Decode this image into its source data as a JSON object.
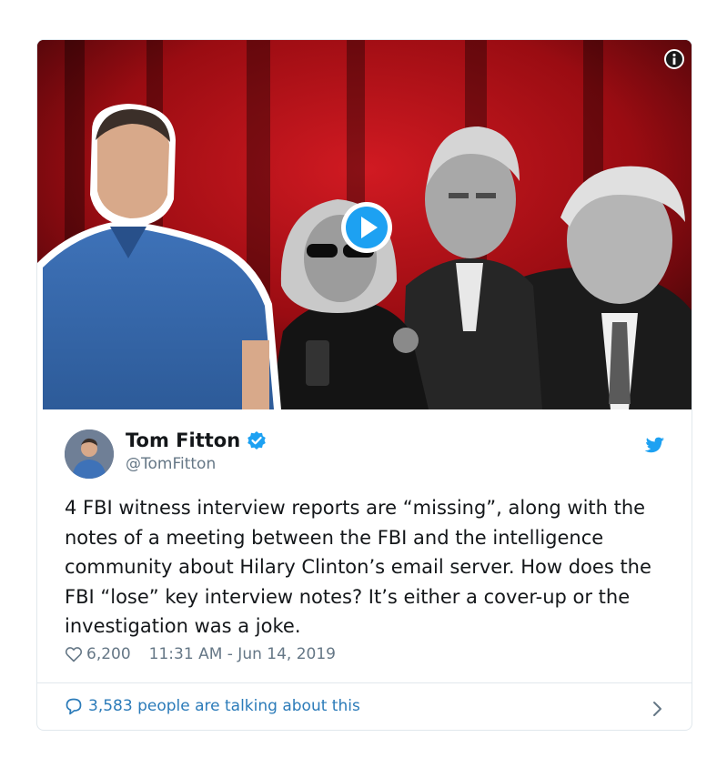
{
  "author": {
    "name": "Tom Fitton",
    "handle": "@TomFitton"
  },
  "tweet": {
    "text": "4 FBI witness interview reports are “missing”, along with the notes of a meeting between the FBI and the intelligence community about Hilary Clinton’s email server. How does the FBI “lose” key interview notes? It’s either a cover-up or the investigation was a joke.",
    "likes": "6,200",
    "timestamp": "11:31 AM - Jun 14, 2019"
  },
  "conversation": {
    "label": "3,583 people are talking about this"
  },
  "icons": {
    "info": "info-icon",
    "play": "play-icon",
    "verified": "verified-badge-icon",
    "brand": "twitter-bird-icon",
    "like": "heart-icon",
    "reply": "speech-bubble-icon",
    "more": "chevron-right-icon"
  },
  "colors": {
    "brand_blue": "#1da1f2",
    "link_blue": "#2b7bb9",
    "text": "#14171a",
    "muted": "#657786",
    "border": "#e1e8ed"
  }
}
